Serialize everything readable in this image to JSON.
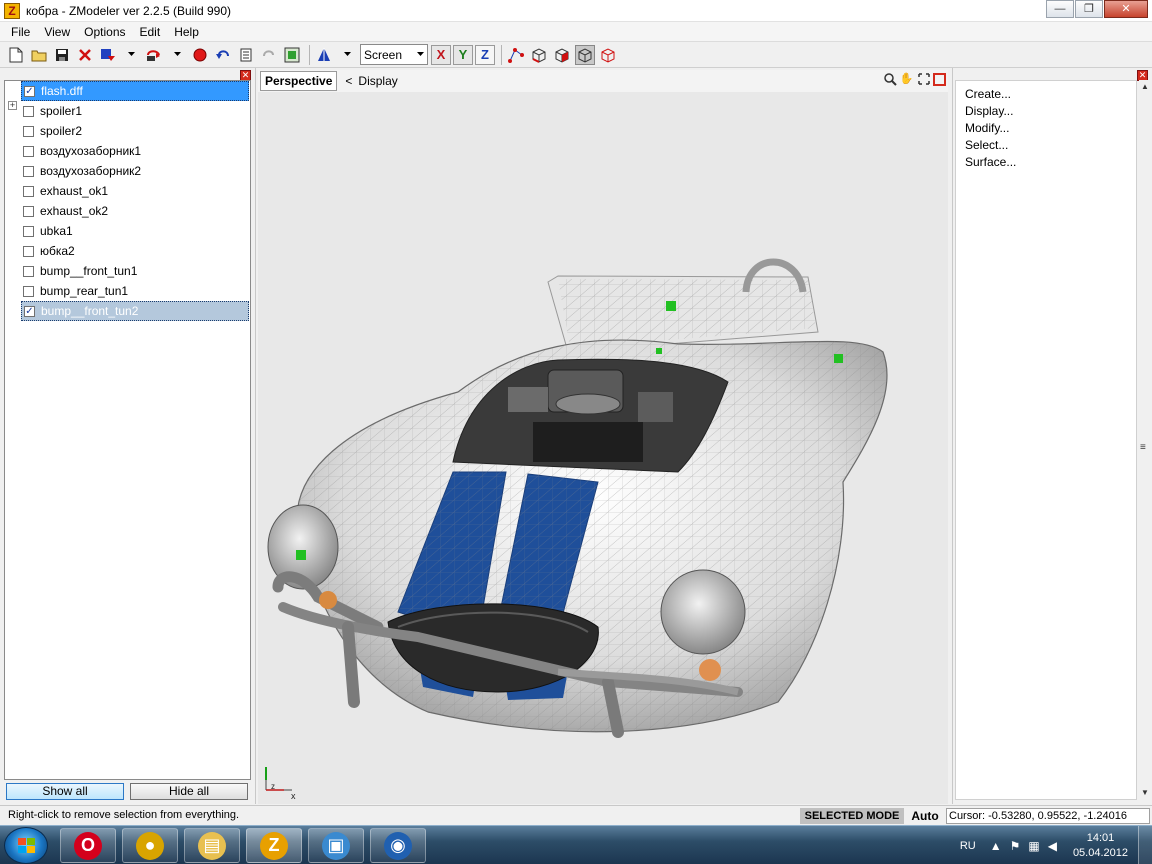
{
  "window": {
    "title": "кобра - ZModeler ver 2.2.5 (Build 990)",
    "app_icon_glyph": "Z",
    "buttons": {
      "minimize": "—",
      "restore": "❐",
      "close": "✕"
    }
  },
  "menu": [
    {
      "label": "File",
      "key": "F"
    },
    {
      "label": "View",
      "key": "V"
    },
    {
      "label": "Options",
      "key": "O"
    },
    {
      "label": "Edit",
      "key": "E"
    },
    {
      "label": "Help",
      "key": "H"
    }
  ],
  "toolbar": {
    "view_select": "Screen",
    "axes": {
      "x": "X",
      "y": "Y",
      "z": "Z"
    },
    "icons": [
      "new-file-icon",
      "open-folder-icon",
      "save-icon",
      "delete-icon",
      "import-icon",
      "export-icon",
      "record-icon",
      "undo-icon",
      "notes-icon",
      "redo-icon",
      "render-icon",
      "mesh-icon"
    ]
  },
  "scene_tree": {
    "items": [
      {
        "label": "flash.dff",
        "checked": true,
        "state": "selected"
      },
      {
        "label": "spoiler1",
        "checked": false,
        "state": "normal"
      },
      {
        "label": "spoiler2",
        "checked": false,
        "state": "normal"
      },
      {
        "label": "воздухозаборник1",
        "checked": false,
        "state": "normal"
      },
      {
        "label": "воздухозаборник2",
        "checked": false,
        "state": "normal"
      },
      {
        "label": "exhaust_ok1",
        "checked": false,
        "state": "normal"
      },
      {
        "label": "exhaust_ok2",
        "checked": false,
        "state": "normal"
      },
      {
        "label": "ubka1",
        "checked": false,
        "state": "normal"
      },
      {
        "label": "юбка2",
        "checked": false,
        "state": "normal"
      },
      {
        "label": "bump__front_tun1",
        "checked": false,
        "state": "normal"
      },
      {
        "label": "bump_rear_tun1",
        "checked": false,
        "state": "normal"
      },
      {
        "label": "bump__front_tun2",
        "checked": true,
        "state": "highlighted"
      }
    ],
    "show_all_label": "Show all",
    "hide_all_label": "Hide all"
  },
  "viewport": {
    "tab_label": "Perspective",
    "breadcrumb_arrow": "<",
    "breadcrumb": "Display",
    "axis_gizmo": {
      "z": "z",
      "x": "x"
    }
  },
  "command_panel": {
    "items": [
      "Create...",
      "Display...",
      "Modify...",
      "Select...",
      "Surface..."
    ]
  },
  "status": {
    "message": "Right-click to remove selection from everything.",
    "mode": "SELECTED MODE",
    "auto": "Auto",
    "cursor": "Cursor: -0.53280, 0.95522, -1.24016"
  },
  "taskbar": {
    "apps": [
      {
        "name": "opera",
        "glyph": "O",
        "color": "#d4001c"
      },
      {
        "name": "chrome",
        "glyph": "●",
        "color": "#d8a400"
      },
      {
        "name": "explorer",
        "glyph": "▤",
        "color": "#e8c050"
      },
      {
        "name": "zmodeler",
        "glyph": "Z",
        "color": "#e8a000"
      },
      {
        "name": "image-viewer",
        "glyph": "▣",
        "color": "#3a8ad0"
      },
      {
        "name": "globe-app",
        "glyph": "◉",
        "color": "#2060b0"
      }
    ],
    "lang": "RU",
    "time": "14:01",
    "date": "05.04.2012"
  }
}
